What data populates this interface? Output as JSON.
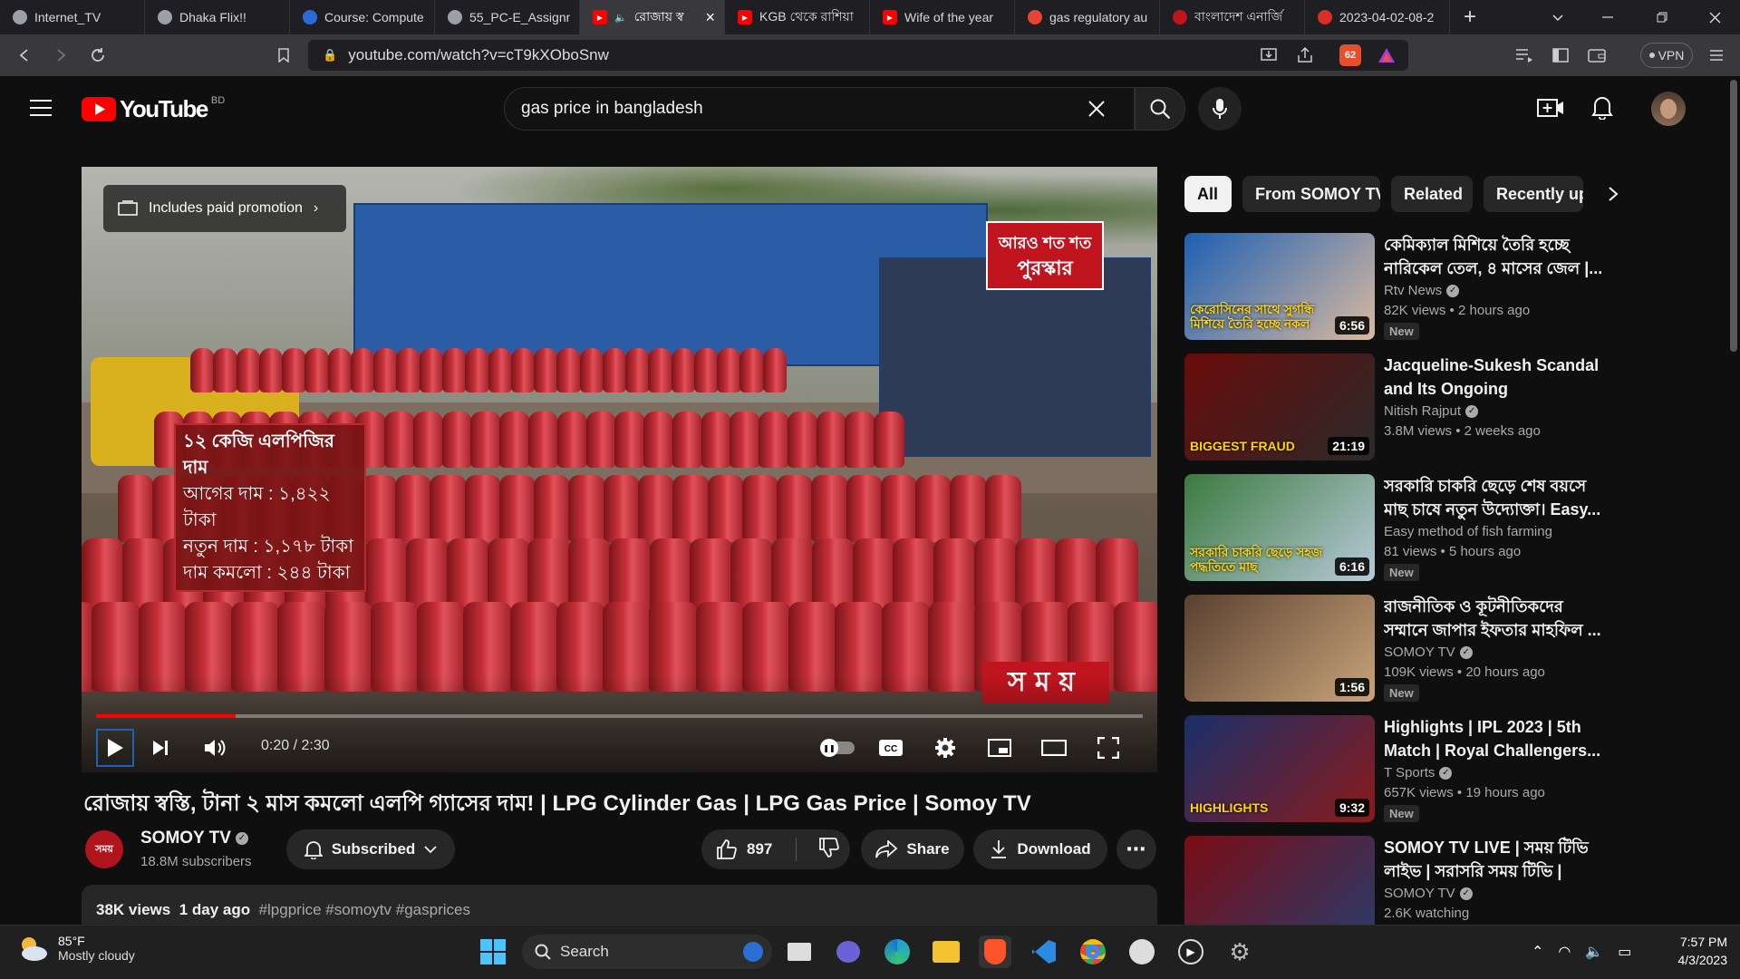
{
  "browser": {
    "tabs": [
      {
        "title": "Internet_TV",
        "icon": "globe-icon",
        "color": "#9aa0a6"
      },
      {
        "title": "Dhaka Flix!!",
        "icon": "globe-icon",
        "color": "#9aa0a6"
      },
      {
        "title": "Course: Compute",
        "icon": "moodle-icon",
        "color": "#2b6ad8"
      },
      {
        "title": "55_PC-E_Assignm",
        "icon": "globe-icon",
        "color": "#9aa0a6"
      },
      {
        "title": "রোজায় স্ব",
        "icon": "youtube-icon",
        "color": "#ff0000",
        "active": true
      },
      {
        "title": "KGB থেকে রাশিয়া",
        "icon": "youtube-icon",
        "color": "#ff0000"
      },
      {
        "title": "Wife of the year",
        "icon": "youtube-icon",
        "color": "#ff0000"
      },
      {
        "title": "gas regulatory au",
        "icon": "google-icon",
        "color": "#ea4335"
      },
      {
        "title": "বাংলাদেশ এনার্জি",
        "icon": "energy-site-icon",
        "color": "#c0151f"
      },
      {
        "title": "2023-04-02-08-2",
        "icon": "doc-site-icon",
        "color": "#d93025"
      }
    ],
    "new_tab": "+",
    "url": "youtube.com/watch?v=cT9kXOboSnw",
    "brave_badge": "62",
    "vpn_label": "VPN"
  },
  "youtube": {
    "logo_text": "YouTube",
    "country_code": "BD",
    "search_value": "gas price in bangladesh"
  },
  "video": {
    "promo_label": "Includes paid promotion",
    "overlay_lines": [
      "১২ কেজি এলপিজির দাম",
      "আগের দাম : ১,৪২২ টাকা",
      "নতুন দাম   : ১,১৭৮ টাকা",
      "দাম কমলো : ২৪৪ টাকা"
    ],
    "badge_line1": "আরও শত শত",
    "badge_line2": "পুরস্কার",
    "logo_watermark": "সময়",
    "time_current": "0:20",
    "time_total": "2:30",
    "progress_fraction": 0.133,
    "title": "রোজায় স্বস্তি, টানা ২ মাস কমলো এলপি গ্যাসের দাম! | LPG Cylinder Gas | LPG Gas Price | Somoy TV",
    "channel_name": "SOMOY TV",
    "channel_avatar_text": "সময়",
    "subscribers": "18.8M subscribers",
    "subscribe_label": "Subscribed",
    "likes": "897",
    "share_label": "Share",
    "download_label": "Download",
    "views": "38K views",
    "age": "1 day ago",
    "hashtags": "#lpgprice #somoytv #gasprices"
  },
  "chips": [
    "All",
    "From SOMOY TV",
    "Related",
    "Recently up"
  ],
  "recommendations": [
    {
      "title": "কেমিক্যাল মিশিয়ে তৈরি হচ্ছে নারিকেল তেল, ৪ মাসের জেল |...",
      "channel": "Rtv News",
      "views": "82K views",
      "age": "2 hours ago",
      "duration": "6:56",
      "new": "New",
      "thumb_caption": "কেরোসিনের সাথে সুগন্ধি মিশিয়ে তৈরি হচ্ছে নকল তে",
      "c1": "#1d5fb3",
      "c2": "#d9b9a0"
    },
    {
      "title": "Jacqueline-Sukesh Scandal and Its Ongoing Investigation |...",
      "channel": "Nitish Rajput",
      "views": "3.8M views",
      "age": "2 weeks ago",
      "duration": "21:19",
      "new": "",
      "thumb_caption": "BIGGEST FRAUD",
      "c1": "#6b0b0b",
      "c2": "#2a2a2a"
    },
    {
      "title": "সরকারি চাকরি ছেড়ে শেষ বয়সে মাছ চাষে নতুন উদ্যোক্তা। Easy...",
      "channel": "Easy method of fish farming",
      "views": "81 views",
      "age": "5 hours ago",
      "duration": "6:16",
      "new": "New",
      "thumb_caption": "সরকারি চাকরি ছেড়ে সহজ পদ্ধতিতে মাছ",
      "c1": "#3b7a3e",
      "c2": "#b8c9d9"
    },
    {
      "title": "রাজনীতিক ও কূটনীতিকদের সম্মানে জাপার ইফতার মাহফিল ...",
      "channel": "SOMOY TV",
      "views": "109K views",
      "age": "20 hours ago",
      "duration": "1:56",
      "new": "New",
      "thumb_caption": "",
      "c1": "#5a4030",
      "c2": "#c9a47a"
    },
    {
      "title": "Highlights | IPL 2023 | 5th Match | Royal Challengers...",
      "channel": "T Sports",
      "views": "657K views",
      "age": "19 hours ago",
      "duration": "9:32",
      "new": "New",
      "thumb_caption": "HIGHLIGHTS",
      "c1": "#1b2f6b",
      "c2": "#8a1a1a"
    },
    {
      "title": "SOMOY TV LIVE | সময় টিভি লাইভ | সরাসরি সময় টিভি | LIVE...",
      "channel": "SOMOY TV",
      "views": "2.6K watching",
      "age": "",
      "duration": "",
      "new": "",
      "thumb_caption": "",
      "c1": "#7a0d14",
      "c2": "#2a3a6a"
    }
  ],
  "taskbar": {
    "temperature": "85°F",
    "weather": "Mostly cloudy",
    "search_label": "Search",
    "time": "7:57 PM",
    "date": "4/3/2023"
  },
  "colors": {
    "accent_red": "#ff0000",
    "bg": "#0f0f0f",
    "chip_bg": "#272727"
  }
}
